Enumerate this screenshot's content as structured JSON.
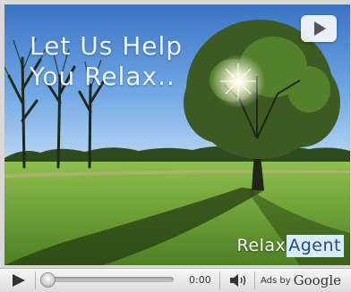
{
  "video": {
    "headline": "Let Us Help\nYou Relax..",
    "brand": {
      "part1": "Relax",
      "part2": "Agent"
    },
    "overlay_icon": "play-icon"
  },
  "controls": {
    "play_icon": "play-icon",
    "time": "0:00",
    "progress": 0,
    "volume_icon": "speaker-icon",
    "ads_by": "Ads by",
    "ads_brand": "Google"
  },
  "colors": {
    "sky": "#4f8fd6",
    "grass": "#79ad3f",
    "headline": "#eaf6ff",
    "brand_highlight": "#d9ecff",
    "brand_agent_text": "#1b4f86"
  }
}
